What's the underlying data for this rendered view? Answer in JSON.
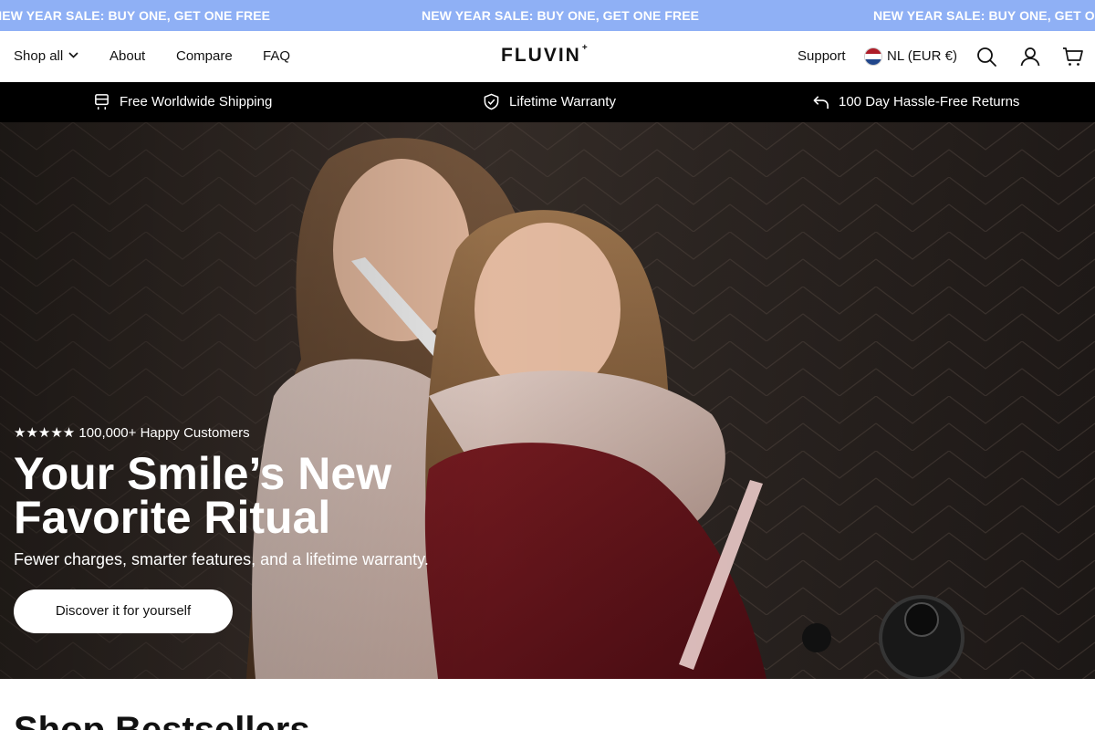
{
  "announcement": {
    "items": [
      "NEW YEAR SALE: BUY ONE, GET ONE FREE",
      "NEW YEAR SALE: BUY ONE, GET ONE FREE",
      "NEW YEAR SALE: BUY ONE, GET ONE FREE"
    ],
    "background": "#8fb0f5"
  },
  "header": {
    "nav": [
      "Shop all",
      "About",
      "Compare",
      "FAQ"
    ],
    "logo": "FLUVIN",
    "logo_mark": "+",
    "support": "Support",
    "locale": "NL (EUR €)",
    "icons": [
      "search-icon",
      "account-icon",
      "cart-icon"
    ]
  },
  "usp": {
    "items": [
      {
        "label": "Free Worldwide Shipping",
        "icon": "shipping-icon"
      },
      {
        "label": "Lifetime Warranty",
        "icon": "shield-check-icon"
      },
      {
        "label": "100 Day Hassle-Free Returns",
        "icon": "return-arrow-icon"
      }
    ]
  },
  "hero": {
    "stars": "★★★★★",
    "rating_text": "100,000+ Happy Customers",
    "title": "Your Smile’s New Favorite Ritual",
    "subtitle": "Fewer charges, smarter features, and a lifetime warranty.",
    "cta": "Discover it for yourself"
  },
  "section": {
    "title": "Shop Bestsellers"
  }
}
